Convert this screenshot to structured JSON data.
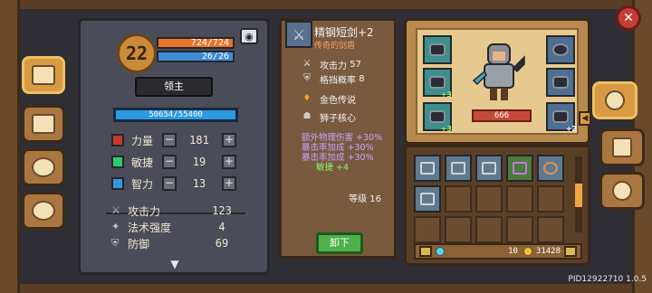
{
  "character": {
    "level": "22",
    "hp": "724/724",
    "mp": "26/26",
    "title": "领主",
    "exp": "50654/55400"
  },
  "attributes": [
    {
      "label": "力量",
      "value": "181",
      "color": "#c0392b",
      "icon": "fist-icon"
    },
    {
      "label": "敏捷",
      "value": "19",
      "color": "#2ecc71",
      "icon": "feather-icon"
    },
    {
      "label": "智力",
      "value": "13",
      "color": "#3498db",
      "icon": "book-icon"
    }
  ],
  "combat_stats": [
    {
      "label": "攻击力",
      "value": "123",
      "icon": "sword-icon"
    },
    {
      "label": "法术强度",
      "value": "4",
      "icon": "wand-icon"
    },
    {
      "label": "防御",
      "value": "69",
      "icon": "shield-icon"
    }
  ],
  "item_detail": {
    "name": "精钢短剑+2",
    "quality": "传奇的剑盾",
    "stats": [
      {
        "label": "攻击力",
        "value": "57",
        "icon": "sword-icon"
      },
      {
        "label": "格挡概率",
        "value": "8",
        "icon": "shield-icon"
      }
    ],
    "tags": [
      {
        "label": "金色传说",
        "icon": "flame-icon"
      },
      {
        "label": "狮子核心",
        "icon": "lion-icon"
      }
    ],
    "bonuses": [
      {
        "text": "额外物理伤害 +30%",
        "color": "lilac"
      },
      {
        "text": "暴击率加成 +30%",
        "color": "lilac"
      },
      {
        "text": "暴击率加成 +30%",
        "color": "lilac"
      },
      {
        "text": "敏捷 +4",
        "color": "green"
      }
    ],
    "level_label": "等级 16",
    "unequip_label": "卸下"
  },
  "equipment": {
    "power": "666",
    "weapon_upgrade": "+2",
    "slots": [
      {
        "name": "helmet-slot",
        "plus": ""
      },
      {
        "name": "chest-slot",
        "plus": "+3"
      },
      {
        "name": "ring-slot",
        "plus": ""
      },
      {
        "name": "boots-slot",
        "plus": "+3"
      },
      {
        "name": "amulet-slot",
        "plus": ""
      },
      {
        "name": "armor-slot",
        "plus": ""
      }
    ]
  },
  "inventory": {
    "gems": "10",
    "gold": "31428"
  },
  "footer": {
    "build_id": "PID12922710 1.0.5"
  }
}
